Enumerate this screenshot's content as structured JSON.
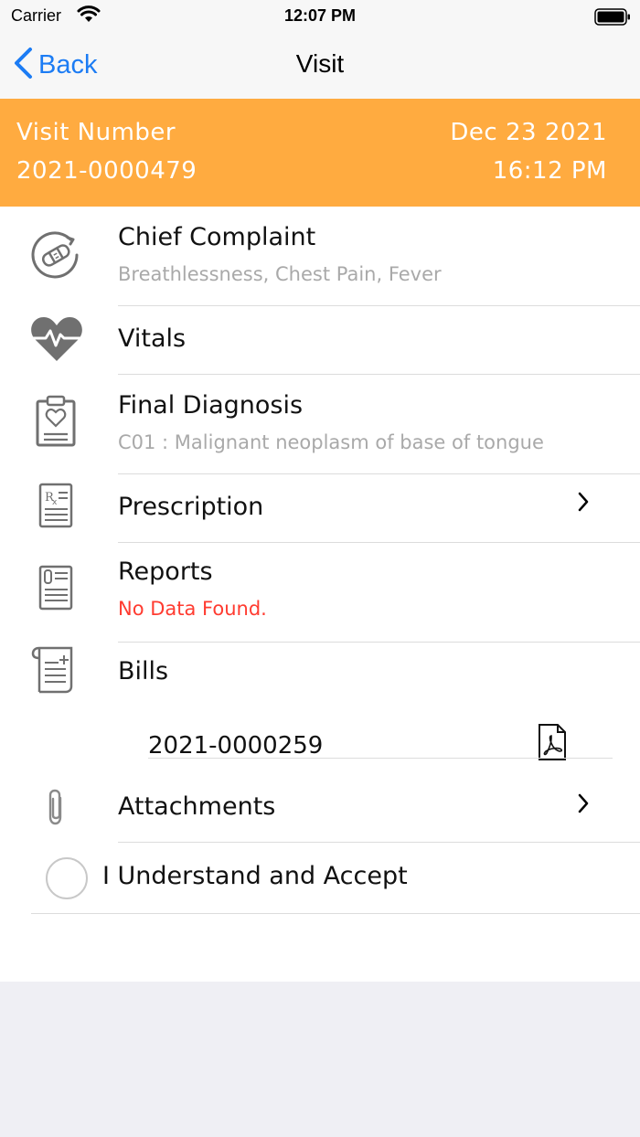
{
  "status_bar": {
    "carrier": "Carrier",
    "time": "12:07 PM"
  },
  "nav": {
    "back_label": "Back",
    "title": "Visit"
  },
  "visit": {
    "number_label": "Visit Number",
    "number": "2021-0000479",
    "date": "Dec 23 2021",
    "time": "16:12 PM"
  },
  "items": {
    "chief_complaint": {
      "title": "Chief Complaint",
      "subtitle": "Breathlessness, Chest Pain, Fever"
    },
    "vitals": {
      "title": "Vitals"
    },
    "final_diagnosis": {
      "title": "Final Diagnosis",
      "subtitle": "C01 : Malignant neoplasm of base of tongue"
    },
    "prescription": {
      "title": "Prescription"
    },
    "reports": {
      "title": "Reports",
      "subtitle": "No Data Found."
    },
    "bills": {
      "title": "Bills",
      "bill_number": "2021-0000259"
    },
    "attachments": {
      "title": "Attachments"
    }
  },
  "accept": {
    "label": "I Understand and Accept",
    "checked": false
  },
  "colors": {
    "accent": "#ffab40",
    "link": "#1c7cf4",
    "error": "#ff3b30",
    "icon": "#707070"
  }
}
